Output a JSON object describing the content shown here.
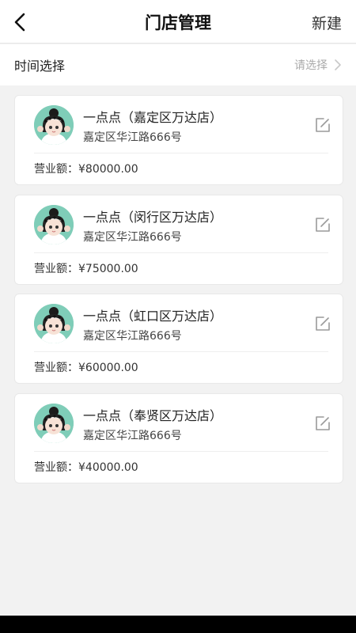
{
  "header": {
    "title": "门店管理",
    "action_label": "新建"
  },
  "filter": {
    "label": "时间选择",
    "placeholder": "请选择"
  },
  "stores": [
    {
      "name": "一点点（嘉定区万达店）",
      "address": "嘉定区华江路666号",
      "revenue_label": "营业额：",
      "revenue": "¥80000.00"
    },
    {
      "name": "一点点（闵行区万达店）",
      "address": "嘉定区华江路666号",
      "revenue_label": "营业额：",
      "revenue": "¥75000.00"
    },
    {
      "name": "一点点（虹口区万达店）",
      "address": "嘉定区华江路666号",
      "revenue_label": "营业额：",
      "revenue": "¥60000.00"
    },
    {
      "name": "一点点（奉贤区万达店）",
      "address": "嘉定区华江路666号",
      "revenue_label": "营业额：",
      "revenue": "¥40000.00"
    }
  ],
  "icons": {
    "back": "chevron-left-icon",
    "chevron": "chevron-right-icon",
    "edit": "edit-icon",
    "avatar": "avatar-icon"
  },
  "colors": {
    "background": "#f2f2f2",
    "card": "#ffffff",
    "avatar_bg": "#7fcdb8"
  }
}
